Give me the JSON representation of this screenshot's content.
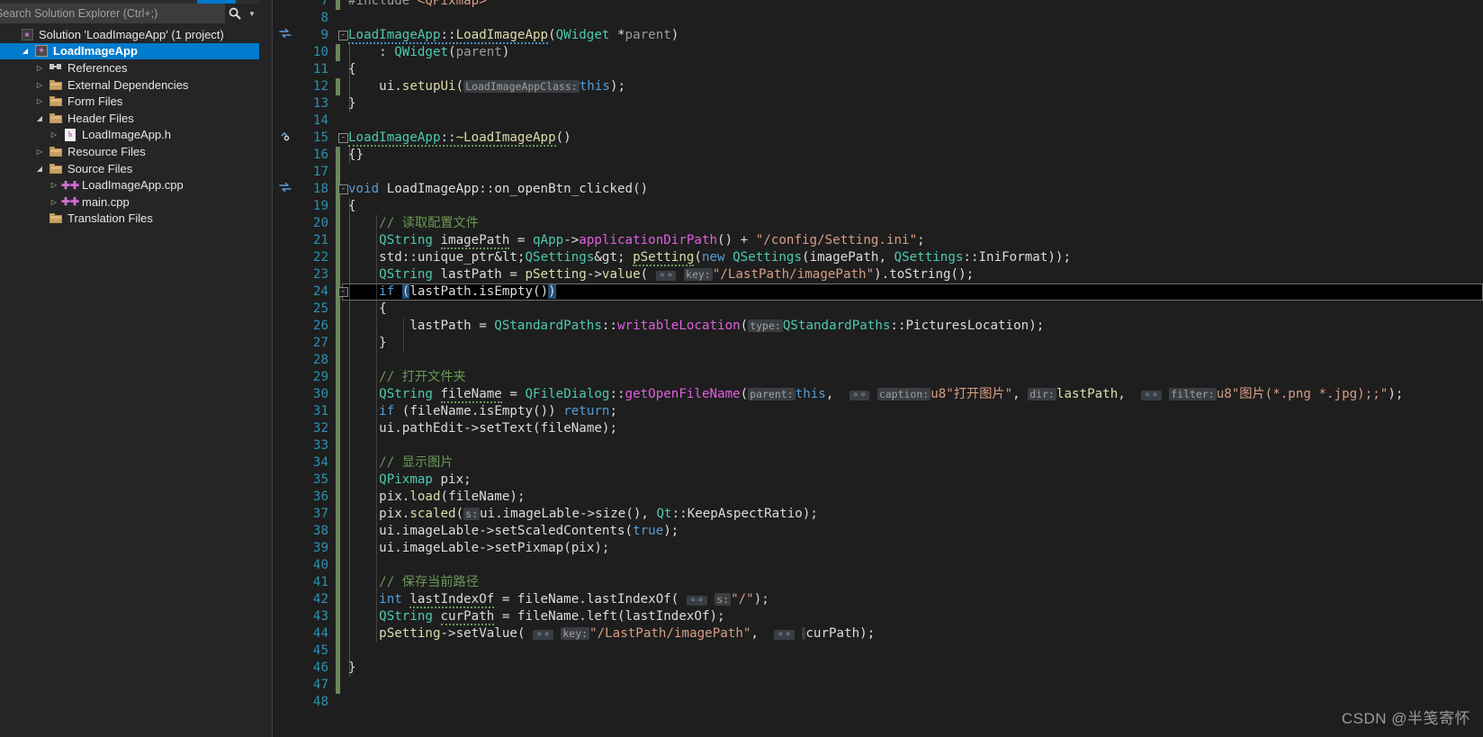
{
  "solution_explorer": {
    "search": {
      "placeholder": "Search Solution Explorer (Ctrl+;)",
      "icon": "search-icon",
      "caret_icon": "chevron-down-icon"
    },
    "tree": [
      {
        "label": "Solution 'LoadImageApp' (1 project)",
        "indent": 0,
        "expander": "",
        "icon": "solution-icon",
        "selected": false,
        "bold": false
      },
      {
        "label": "LoadImageApp",
        "indent": 1,
        "expander": "◢",
        "icon": "project-icon",
        "selected": true,
        "bold": true
      },
      {
        "label": "References",
        "indent": 2,
        "expander": "▷",
        "icon": "references-icon",
        "selected": false,
        "bold": false
      },
      {
        "label": "External Dependencies",
        "indent": 2,
        "expander": "▷",
        "icon": "folder-icon",
        "selected": false,
        "bold": false
      },
      {
        "label": "Form Files",
        "indent": 2,
        "expander": "▷",
        "icon": "folder-icon",
        "selected": false,
        "bold": false
      },
      {
        "label": "Header Files",
        "indent": 2,
        "expander": "◢",
        "icon": "folder-icon",
        "selected": false,
        "bold": false
      },
      {
        "label": "LoadImageApp.h",
        "indent": 3,
        "expander": "▷",
        "icon": "header-file-icon",
        "selected": false,
        "bold": false
      },
      {
        "label": "Resource Files",
        "indent": 2,
        "expander": "▷",
        "icon": "folder-icon",
        "selected": false,
        "bold": false
      },
      {
        "label": "Source Files",
        "indent": 2,
        "expander": "◢",
        "icon": "folder-icon",
        "selected": false,
        "bold": false
      },
      {
        "label": "LoadImageApp.cpp",
        "indent": 3,
        "expander": "▷",
        "icon": "cpp-file-icon",
        "selected": false,
        "bold": false
      },
      {
        "label": "main.cpp",
        "indent": 3,
        "expander": "▷",
        "icon": "cpp-file-icon",
        "selected": false,
        "bold": false
      },
      {
        "label": "Translation Files",
        "indent": 2,
        "expander": "",
        "icon": "folder-icon",
        "selected": false,
        "bold": false
      }
    ]
  },
  "editor": {
    "current_line": 24,
    "lines": [
      {
        "n": 7,
        "changed": true,
        "fold": "",
        "glyph": "",
        "text": "#include <QPixmap>"
      },
      {
        "n": 8,
        "changed": false,
        "fold": "",
        "glyph": "",
        "text": ""
      },
      {
        "n": 9,
        "changed": false,
        "fold": "-",
        "glyph": "references-icon",
        "text": "LoadImageApp::LoadImageApp(QWidget *parent)"
      },
      {
        "n": 10,
        "changed": true,
        "fold": "",
        "glyph": "",
        "text": "    : QWidget(parent)"
      },
      {
        "n": 11,
        "changed": false,
        "fold": "",
        "glyph": "",
        "text": "{"
      },
      {
        "n": 12,
        "changed": true,
        "fold": "",
        "glyph": "",
        "text": "    ui.setupUi(LoadImageAppClass: this);"
      },
      {
        "n": 13,
        "changed": false,
        "fold": "",
        "glyph": "",
        "text": "}"
      },
      {
        "n": 14,
        "changed": false,
        "fold": "",
        "glyph": "",
        "text": ""
      },
      {
        "n": 15,
        "changed": false,
        "fold": "-",
        "glyph": "destructor-icon",
        "text": "LoadImageApp::~LoadImageApp()"
      },
      {
        "n": 16,
        "changed": true,
        "fold": "",
        "glyph": "",
        "text": "{}"
      },
      {
        "n": 17,
        "changed": true,
        "fold": "",
        "glyph": "",
        "text": ""
      },
      {
        "n": 18,
        "changed": true,
        "fold": "-",
        "glyph": "references-icon",
        "text": "void LoadImageApp::on_openBtn_clicked()"
      },
      {
        "n": 19,
        "changed": true,
        "fold": "",
        "glyph": "",
        "text": "{"
      },
      {
        "n": 20,
        "changed": true,
        "fold": "",
        "glyph": "",
        "text": "    // 读取配置文件"
      },
      {
        "n": 21,
        "changed": true,
        "fold": "",
        "glyph": "",
        "text": "    QString imagePath = qApp->applicationDirPath() + \"/config/Setting.ini\";"
      },
      {
        "n": 22,
        "changed": true,
        "fold": "",
        "glyph": "",
        "text": "    std::unique_ptr<QSettings> pSetting(new QSettings(imagePath, QSettings::IniFormat));"
      },
      {
        "n": 23,
        "changed": true,
        "fold": "",
        "glyph": "",
        "text": "    QString lastPath = pSetting->value( key: \"/LastPath/imagePath\").toString();"
      },
      {
        "n": 24,
        "changed": true,
        "fold": "-",
        "glyph": "",
        "text": "    if (lastPath.isEmpty())"
      },
      {
        "n": 25,
        "changed": true,
        "fold": "",
        "glyph": "",
        "text": "    {"
      },
      {
        "n": 26,
        "changed": true,
        "fold": "",
        "glyph": "",
        "text": "        lastPath = QStandardPaths::writableLocation( type: QStandardPaths::PicturesLocation);"
      },
      {
        "n": 27,
        "changed": true,
        "fold": "",
        "glyph": "",
        "text": "    }"
      },
      {
        "n": 28,
        "changed": true,
        "fold": "",
        "glyph": "",
        "text": ""
      },
      {
        "n": 29,
        "changed": true,
        "fold": "",
        "glyph": "",
        "text": "    // 打开文件夹"
      },
      {
        "n": 30,
        "changed": true,
        "fold": "",
        "glyph": "",
        "text": "    QString fileName = QFileDialog::getOpenFileName( parent: this,  caption: u8\"打开图片\",  dir: lastPath,  filter: u8\"图片(*.png *.jpg);;\");"
      },
      {
        "n": 31,
        "changed": true,
        "fold": "",
        "glyph": "",
        "text": "    if (fileName.isEmpty()) return;"
      },
      {
        "n": 32,
        "changed": true,
        "fold": "",
        "glyph": "",
        "text": "    ui.pathEdit->setText(fileName);"
      },
      {
        "n": 33,
        "changed": true,
        "fold": "",
        "glyph": "",
        "text": ""
      },
      {
        "n": 34,
        "changed": true,
        "fold": "",
        "glyph": "",
        "text": "    // 显示图片"
      },
      {
        "n": 35,
        "changed": true,
        "fold": "",
        "glyph": "",
        "text": "    QPixmap pix;"
      },
      {
        "n": 36,
        "changed": true,
        "fold": "",
        "glyph": "",
        "text": "    pix.load(fileName);"
      },
      {
        "n": 37,
        "changed": true,
        "fold": "",
        "glyph": "",
        "text": "    pix.scaled( s: ui.imageLable->size(), Qt::KeepAspectRatio);"
      },
      {
        "n": 38,
        "changed": true,
        "fold": "",
        "glyph": "",
        "text": "    ui.imageLable->setScaledContents(true);"
      },
      {
        "n": 39,
        "changed": true,
        "fold": "",
        "glyph": "",
        "text": "    ui.imageLable->setPixmap(pix);"
      },
      {
        "n": 40,
        "changed": true,
        "fold": "",
        "glyph": "",
        "text": ""
      },
      {
        "n": 41,
        "changed": true,
        "fold": "",
        "glyph": "",
        "text": "    // 保存当前路径"
      },
      {
        "n": 42,
        "changed": true,
        "fold": "",
        "glyph": "",
        "text": "    int lastIndexOf = fileName.lastIndexOf( s: \"/\");"
      },
      {
        "n": 43,
        "changed": true,
        "fold": "",
        "glyph": "",
        "text": "    QString curPath = fileName.left(lastIndexOf);"
      },
      {
        "n": 44,
        "changed": true,
        "fold": "",
        "glyph": "",
        "text": "    pSetting->setValue( key: \"/LastPath/imagePath\",  curPath);"
      },
      {
        "n": 45,
        "changed": true,
        "fold": "",
        "glyph": "",
        "text": ""
      },
      {
        "n": 46,
        "changed": true,
        "fold": "",
        "glyph": "",
        "text": "}"
      },
      {
        "n": 47,
        "changed": true,
        "fold": "",
        "glyph": "",
        "text": ""
      },
      {
        "n": 48,
        "changed": false,
        "fold": "",
        "glyph": "",
        "text": ""
      }
    ]
  },
  "watermark": {
    "text": "CSDN @半笺寄怀"
  },
  "colors": {
    "editor_bg": "#1e1e1e",
    "panel_bg": "#252526",
    "selection_blue": "#007acc",
    "linenum": "#2b91af",
    "comment": "#6a9955",
    "string": "#d69d85",
    "keyword": "#569cd6",
    "type": "#4ec9b0",
    "function": "#dcdcaa",
    "static_fn": "#e05fe0",
    "changebar": "#6a8759"
  }
}
